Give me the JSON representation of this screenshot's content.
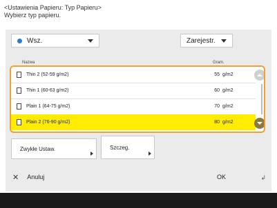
{
  "header": {
    "line1": "<Ustawienia Papieru: Typ Papieru>",
    "line2": "Wybierz typ papieru."
  },
  "filter": {
    "selected": "Wsz."
  },
  "sort": {
    "selected": "Zarejestr."
  },
  "columns": {
    "name": "Nazwa",
    "gram": "Gram."
  },
  "rows": [
    {
      "name": "Thin 2 (52-59 g/m2)",
      "gram": "55",
      "unit": "g/m2",
      "selected": false
    },
    {
      "name": "Thin 1 (60-63 g/m2)",
      "gram": "60",
      "unit": "g/m2",
      "selected": false
    },
    {
      "name": "Plain 1 (64-75 g/m2)",
      "gram": "70",
      "unit": "g/m2",
      "selected": false
    },
    {
      "name": "Plain 2 (76-90 g/m2)",
      "gram": "80",
      "unit": "g/m2",
      "selected": true
    }
  ],
  "buttons": {
    "default_settings": "Zwykłe Ustaw.",
    "details": "Szczeg.",
    "cancel": "Anuluj",
    "ok": "OK"
  },
  "colors": {
    "accent_orange": "#f0a030",
    "selection_yellow": "#ffec00",
    "filter_dot_blue": "#2a7bd0"
  }
}
